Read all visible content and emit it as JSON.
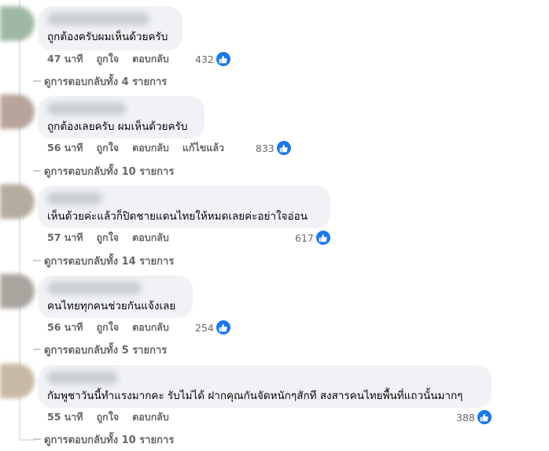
{
  "comments": [
    {
      "text": "ถูกต้องครับผมเห็นด้วยครับ",
      "time": "47 นาที",
      "like": "ถูกใจ",
      "reply": "ตอบกลับ",
      "edited": "",
      "reactions": "432",
      "view_replies": "ดูการตอบกลับทั้ง 4 รายการ"
    },
    {
      "text": "ถูกต้องเลยครับ ผมเห็นด้วยครับ",
      "time": "56 นาที",
      "like": "ถูกใจ",
      "reply": "ตอบกลับ",
      "edited": "แก้ไขแล้ว",
      "reactions": "833",
      "view_replies": "ดูการตอบกลับทั้ง 10 รายการ"
    },
    {
      "text": "เห็นด้วยค่ะแล้วก็ปิดชายแดนไทยให้หมดเลยค่ะอย่าใจอ่อน",
      "time": "57 นาที",
      "like": "ถูกใจ",
      "reply": "ตอบกลับ",
      "edited": "",
      "reactions": "617",
      "view_replies": "ดูการตอบกลับทั้ง 14 รายการ"
    },
    {
      "text": "คนไทยทุกคนช่วยกันแจ้งเลย",
      "time": "56 นาที",
      "like": "ถูกใจ",
      "reply": "ตอบกลับ",
      "edited": "",
      "reactions": "254",
      "view_replies": "ดูการตอบกลับทั้ง 5 รายการ"
    },
    {
      "text": "กัมพูชาวันนี้ทำแรงมากคะ รับไม่ได้ ฝากคุณกันจัดหนักๆสักที สงสารคนไทยพื้นที่แถวนั้นมากๆ",
      "time": "55 นาที",
      "like": "ถูกใจ",
      "reply": "ตอบกลับ",
      "edited": "",
      "reactions": "388",
      "view_replies": "ดูการตอบกลับทั้ง 10 รายการ"
    }
  ],
  "reaction_icon": "thumbs-up-icon",
  "colors": {
    "bubble": "#f0f2f5",
    "like_blue": "#1877f2",
    "meta_gray": "#65676b",
    "text": "#050505"
  }
}
